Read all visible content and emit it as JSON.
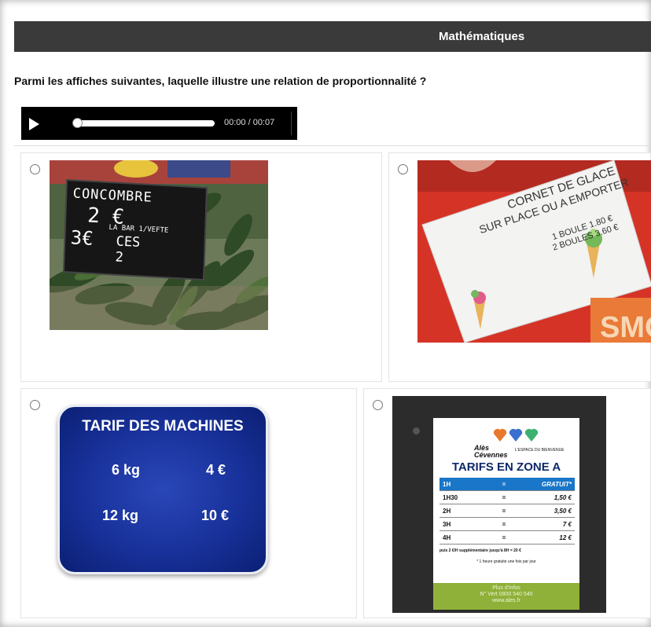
{
  "header": {
    "title": "Mathématiques"
  },
  "question": {
    "text": "Parmi les affiches suivantes, laquelle illustre une relation de proportionnalité ?"
  },
  "audio": {
    "time": "00:00 / 00:07"
  },
  "options": [
    {
      "sign": {
        "title": "CONCOMBRE",
        "price1": "2 €",
        "price2": "3€",
        "extra1": "LA BAR 1/VEFTE",
        "extra2": "CES 2"
      }
    },
    {
      "sign": {
        "line1": "CORNET DE GLACE",
        "line2": "SUR PLACE OU A EMPORTER",
        "line3": "1 BOULE 1.80 €",
        "line4": "2 BOULES 3.60 €",
        "bg_word": "SMOO"
      }
    },
    {
      "sign": {
        "title": "TARIF DES MACHINES",
        "rows": [
          {
            "weight": "6 kg",
            "price": "4 €"
          },
          {
            "weight": "12 kg",
            "price": "10 €"
          }
        ]
      }
    },
    {
      "sign": {
        "brand": "Alès Cévennes",
        "brand_sub": "L'ESPACE DU BIENVENUE",
        "title": "TARIFS EN ZONE A",
        "rows": [
          {
            "d": "1H",
            "eq": "=",
            "p": "GRATUIT*"
          },
          {
            "d": "1H30",
            "eq": "=",
            "p": "1,50 €"
          },
          {
            "d": "2H",
            "eq": "=",
            "p": "3,50 €"
          },
          {
            "d": "3H",
            "eq": "=",
            "p": "7 €"
          },
          {
            "d": "4H",
            "eq": "=",
            "p": "12 €"
          }
        ],
        "note1": "puis 2 €/H supplémentaire jusqu'à 8H = 20 €",
        "note2": "* 1 heure gratuite une fois par jour",
        "footer1": "Plus d'infos",
        "footer2": "N° Vert 0800 540 540",
        "footer3": "www.ales.fr"
      }
    }
  ]
}
